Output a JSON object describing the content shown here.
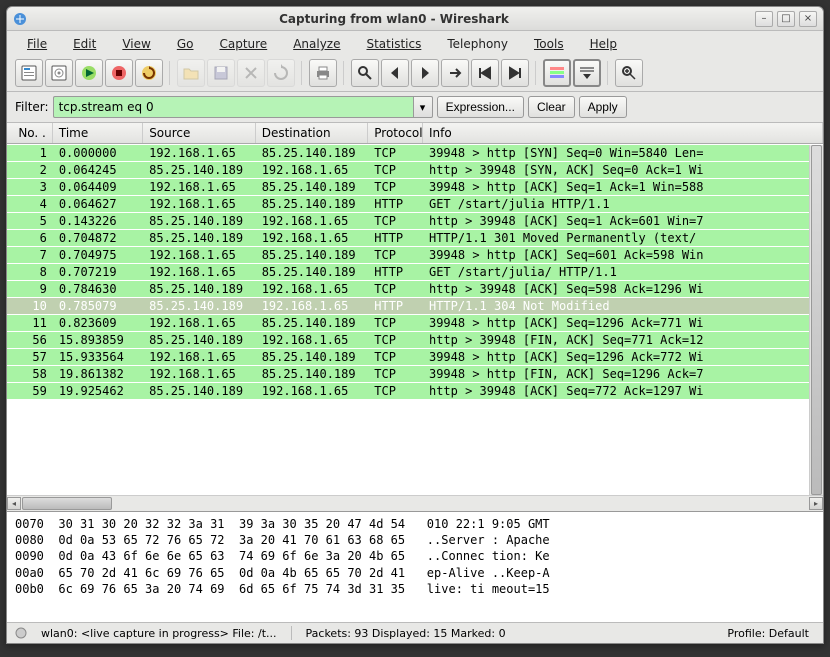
{
  "window": {
    "title": "Capturing from wlan0 - Wireshark"
  },
  "menus": {
    "file": "File",
    "edit": "Edit",
    "view": "View",
    "go": "Go",
    "capture": "Capture",
    "analyze": "Analyze",
    "statistics": "Statistics",
    "telephony": "Telephony",
    "tools": "Tools",
    "help": "Help"
  },
  "filter": {
    "label": "Filter:",
    "value": "tcp.stream eq 0",
    "expression": "Expression...",
    "clear": "Clear",
    "apply": "Apply"
  },
  "columns": {
    "no": "No. .",
    "time": "Time",
    "source": "Source",
    "destination": "Destination",
    "protocol": "Protocol",
    "info": "Info"
  },
  "packets": [
    {
      "no": "1",
      "time": "0.000000",
      "src": "192.168.1.65",
      "dst": "85.25.140.189",
      "proto": "TCP",
      "info": "39948 > http [SYN] Seq=0 Win=5840 Len="
    },
    {
      "no": "2",
      "time": "0.064245",
      "src": "85.25.140.189",
      "dst": "192.168.1.65",
      "proto": "TCP",
      "info": "http > 39948 [SYN, ACK] Seq=0 Ack=1 Wi"
    },
    {
      "no": "3",
      "time": "0.064409",
      "src": "192.168.1.65",
      "dst": "85.25.140.189",
      "proto": "TCP",
      "info": "39948 > http [ACK] Seq=1 Ack=1 Win=588"
    },
    {
      "no": "4",
      "time": "0.064627",
      "src": "192.168.1.65",
      "dst": "85.25.140.189",
      "proto": "HTTP",
      "info": "GET /start/julia HTTP/1.1"
    },
    {
      "no": "5",
      "time": "0.143226",
      "src": "85.25.140.189",
      "dst": "192.168.1.65",
      "proto": "TCP",
      "info": "http > 39948 [ACK] Seq=1 Ack=601 Win=7"
    },
    {
      "no": "6",
      "time": "0.704872",
      "src": "85.25.140.189",
      "dst": "192.168.1.65",
      "proto": "HTTP",
      "info": "HTTP/1.1 301 Moved Permanently  (text/"
    },
    {
      "no": "7",
      "time": "0.704975",
      "src": "192.168.1.65",
      "dst": "85.25.140.189",
      "proto": "TCP",
      "info": "39948 > http [ACK] Seq=601 Ack=598 Win"
    },
    {
      "no": "8",
      "time": "0.707219",
      "src": "192.168.1.65",
      "dst": "85.25.140.189",
      "proto": "HTTP",
      "info": "GET /start/julia/ HTTP/1.1"
    },
    {
      "no": "9",
      "time": "0.784630",
      "src": "85.25.140.189",
      "dst": "192.168.1.65",
      "proto": "TCP",
      "info": "http > 39948 [ACK] Seq=598 Ack=1296 Wi"
    },
    {
      "no": "10",
      "time": "0.785079",
      "src": "85.25.140.189",
      "dst": "192.168.1.65",
      "proto": "HTTP",
      "info": "HTTP/1.1 304 Not Modified",
      "sel": true
    },
    {
      "no": "11",
      "time": "0.823609",
      "src": "192.168.1.65",
      "dst": "85.25.140.189",
      "proto": "TCP",
      "info": "39948 > http [ACK] Seq=1296 Ack=771 Wi"
    },
    {
      "no": "56",
      "time": "15.893859",
      "src": "85.25.140.189",
      "dst": "192.168.1.65",
      "proto": "TCP",
      "info": "http > 39948 [FIN, ACK] Seq=771 Ack=12"
    },
    {
      "no": "57",
      "time": "15.933564",
      "src": "192.168.1.65",
      "dst": "85.25.140.189",
      "proto": "TCP",
      "info": "39948 > http [ACK] Seq=1296 Ack=772 Wi"
    },
    {
      "no": "58",
      "time": "19.861382",
      "src": "192.168.1.65",
      "dst": "85.25.140.189",
      "proto": "TCP",
      "info": "39948 > http [FIN, ACK] Seq=1296 Ack=7"
    },
    {
      "no": "59",
      "time": "19.925462",
      "src": "85.25.140.189",
      "dst": "192.168.1.65",
      "proto": "TCP",
      "info": "http > 39948 [ACK] Seq=772 Ack=1297 Wi"
    }
  ],
  "hex": [
    {
      "off": "0070",
      "b1": "30 31 30 20 32 32 3a 31",
      "b2": "39 3a 30 35 20 47 4d 54",
      "asc": "010 22:1 9:05 GMT"
    },
    {
      "off": "0080",
      "b1": "0d 0a 53 65 72 76 65 72",
      "b2": "3a 20 41 70 61 63 68 65",
      "asc": "..Server : Apache"
    },
    {
      "off": "0090",
      "b1": "0d 0a 43 6f 6e 6e 65 63",
      "b2": "74 69 6f 6e 3a 20 4b 65",
      "asc": "..Connec tion: Ke"
    },
    {
      "off": "00a0",
      "b1": "65 70 2d 41 6c 69 76 65",
      "b2": "0d 0a 4b 65 65 70 2d 41",
      "asc": "ep-Alive ..Keep-A"
    },
    {
      "off": "00b0",
      "b1": "6c 69 76 65 3a 20 74 69",
      "b2": "6d 65 6f 75 74 3d 31 35",
      "asc": "live: ti meout=15"
    }
  ],
  "status": {
    "iface": "wlan0: <live capture in progress> File: /t...",
    "packets": "Packets: 93 Displayed: 15 Marked: 0",
    "profile": "Profile: Default"
  }
}
